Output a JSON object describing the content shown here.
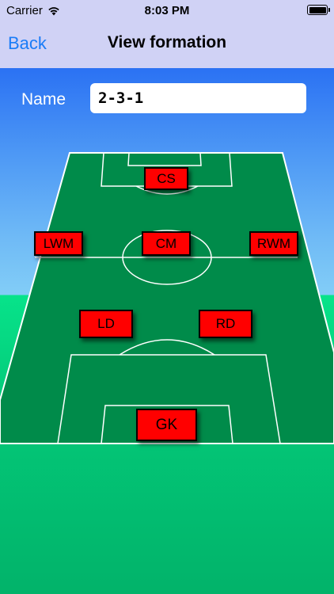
{
  "status_bar": {
    "carrier": "Carrier",
    "time": "8:03 PM"
  },
  "nav": {
    "back_label": "Back",
    "title": "View formation"
  },
  "form": {
    "name_label": "Name",
    "name_value": "2-3-1"
  },
  "positions": {
    "cs": "CS",
    "lwm": "LWM",
    "cm": "CM",
    "rwm": "RWM",
    "ld": "LD",
    "rd": "RD",
    "gk": "GK"
  },
  "colors": {
    "accent": "#1a7cf7",
    "nav_background": "#d0d2f5",
    "pitch": "#008b4a",
    "position_marker": "#ff0000"
  }
}
